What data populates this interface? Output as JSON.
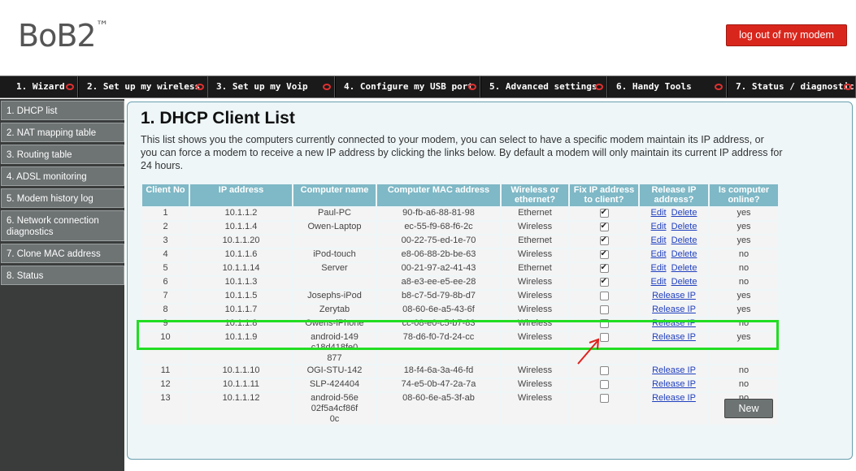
{
  "brand": {
    "name": "BoB2",
    "tm": "™"
  },
  "header": {
    "logout_label": "log out of my modem"
  },
  "nav": {
    "tabs": [
      {
        "label": "1. Wizard"
      },
      {
        "label": "2. Set up my wireless"
      },
      {
        "label": "3. Set up my Voip"
      },
      {
        "label": "4. Configure my USB port"
      },
      {
        "label": "5. Advanced settings"
      },
      {
        "label": "6. Handy Tools"
      },
      {
        "label": "7. Status / diagnostic"
      }
    ]
  },
  "sidebar": {
    "items": [
      {
        "label": "1. DHCP list"
      },
      {
        "label": "2. NAT mapping table"
      },
      {
        "label": "3. Routing table"
      },
      {
        "label": "4. ADSL monitoring"
      },
      {
        "label": "5. Modem history log"
      },
      {
        "label": "6. Network connection diagnostics"
      },
      {
        "label": "7. Clone MAC address"
      },
      {
        "label": "8. Status"
      }
    ]
  },
  "main": {
    "title": "1. DHCP Client List",
    "description": "This list shows you the computers currently connected to your modem, you can select to have a specific modem maintain its IP address, or you can force a modem to receive a new IP address by clicking the links below. By default a modem will only maintain its current IP address for 24 hours.",
    "new_label": "New"
  },
  "table": {
    "headers": [
      "Client No",
      "IP address",
      "Computer name",
      "Computer MAC address",
      "Wireless or ethernet?",
      "Fix IP address to client?",
      "Release IP address?",
      "Is computer online?"
    ],
    "edit_label": "Edit",
    "delete_label": "Delete",
    "release_label": "Release IP",
    "rows": [
      {
        "no": "1",
        "ip": "10.1.1.2",
        "name": "Paul-PC",
        "mac": "90-fb-a6-88-81-98",
        "conn": "Ethernet",
        "fixed": true,
        "online": "yes"
      },
      {
        "no": "2",
        "ip": "10.1.1.4",
        "name": "Owen-Laptop",
        "mac": "ec-55-f9-68-f6-2c",
        "conn": "Wireless",
        "fixed": true,
        "online": "yes"
      },
      {
        "no": "3",
        "ip": "10.1.1.20",
        "name": "",
        "mac": "00-22-75-ed-1e-70",
        "conn": "Ethernet",
        "fixed": true,
        "online": "yes"
      },
      {
        "no": "4",
        "ip": "10.1.1.6",
        "name": "iPod-touch",
        "mac": "e8-06-88-2b-be-63",
        "conn": "Wireless",
        "fixed": true,
        "online": "no"
      },
      {
        "no": "5",
        "ip": "10.1.1.14",
        "name": "Server",
        "mac": "00-21-97-a2-41-43",
        "conn": "Ethernet",
        "fixed": true,
        "online": "no"
      },
      {
        "no": "6",
        "ip": "10.1.1.3",
        "name": "",
        "mac": "a8-e3-ee-e5-ee-28",
        "conn": "Wireless",
        "fixed": true,
        "online": "no"
      },
      {
        "no": "7",
        "ip": "10.1.1.5",
        "name": "Josephs-iPod",
        "mac": "b8-c7-5d-79-8b-d7",
        "conn": "Wireless",
        "fixed": false,
        "online": "yes"
      },
      {
        "no": "8",
        "ip": "10.1.1.7",
        "name": "Zerytab",
        "mac": "08-60-6e-a5-43-6f",
        "conn": "Wireless",
        "fixed": false,
        "online": "yes"
      },
      {
        "no": "9",
        "ip": "10.1.1.8",
        "name": "Owens-iPhone",
        "mac": "cc-08-e0-c5-b7-83",
        "conn": "Wireless",
        "fixed": false,
        "online": "no"
      },
      {
        "no": "10",
        "ip": "10.1.1.9",
        "name": "android-149c18d418fe0877",
        "mac": "78-d6-f0-7d-24-cc",
        "conn": "Wireless",
        "fixed": false,
        "online": "yes"
      },
      {
        "no": "11",
        "ip": "10.1.1.10",
        "name": "OGI-STU-142",
        "mac": "18-f4-6a-3a-46-fd",
        "conn": "Wireless",
        "fixed": false,
        "online": "no"
      },
      {
        "no": "12",
        "ip": "10.1.1.11",
        "name": "SLP-424404",
        "mac": "74-e5-0b-47-2a-7a",
        "conn": "Wireless",
        "fixed": false,
        "online": "no"
      },
      {
        "no": "13",
        "ip": "10.1.1.12",
        "name": "android-56e02f5a4cf86f0c",
        "mac": "08-60-6e-a5-3f-ab",
        "conn": "Wireless",
        "fixed": false,
        "online": "no"
      }
    ]
  },
  "colors": {
    "accent": "#7fb8c6",
    "logout": "#d9261c",
    "highlight": "#22dd22",
    "annotation": "#e0201c"
  }
}
